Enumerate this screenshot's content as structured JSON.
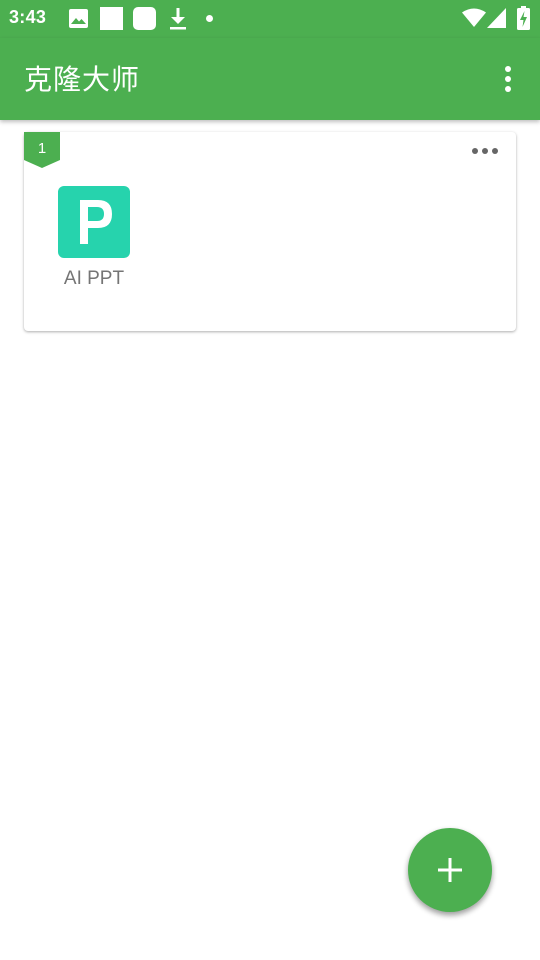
{
  "status_bar": {
    "time": "3:43",
    "left_icons": [
      "image-icon",
      "square-icon",
      "rounded-square-icon",
      "download-icon",
      "dot-icon"
    ],
    "right_icons": [
      "wifi-icon",
      "signal-icon",
      "battery-charging-icon"
    ]
  },
  "app_bar": {
    "title": "克隆大师",
    "menu_icon": "more-vertical-icon"
  },
  "card": {
    "badge": "1",
    "more_icon": "more-horizontal-icon",
    "apps": [
      {
        "label": "AI PPT",
        "icon_letter": "P",
        "icon_color": "#26d3ad"
      }
    ]
  },
  "fab": {
    "icon": "plus-icon"
  },
  "colors": {
    "primary": "#4caf50",
    "app_icon": "#26d3ad",
    "label_text": "#757575"
  }
}
